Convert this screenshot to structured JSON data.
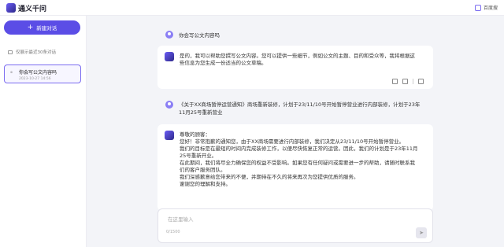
{
  "app": {
    "title": "通义千问"
  },
  "user": {
    "name": "百度搜"
  },
  "sidebar": {
    "new_chat_label": "新建对话",
    "history_note": "仅展示最近30条对话",
    "conversations": [
      {
        "title": "你会写公文内容吗",
        "time": "2023-10-27 14:56"
      }
    ]
  },
  "chat": {
    "q1": "你会写公文内容吗",
    "a1": "是的，我可以帮助您撰写公文内容。您可以提供一些细节，例如公文的主题、目的和受众等，我将根据这些信息为您生成一份适当的公文草稿。",
    "q2": "《关于XX商场暂停运营通知》商场重新装修，计划于23/11/10号开始暂停营业进行内部装修，计划于23年11月25号重新营业",
    "a2": [
      "尊敬的顾客：",
      "您好！非常抱歉的通知您，由于XX商场需要进行内部装修，我们决定从23/11/10号开始暂停营业。",
      "我们的目标是在最短的时间内完成装修工作，以便尽快恢复正常的运营。因此，我们的计划是于23年11月25号重新开业。",
      "在此期间，我们将尽全力确保您的权益不受影响。如果您有任何疑问或需要进一步的帮助，请随时联系我们的客户服务团队。",
      "我们深感歉意给您带来的不便，并期待在不久的将来再次为您提供优质的服务。",
      "谢谢您的理解和支持。"
    ]
  },
  "input": {
    "placeholder": "在这里输入",
    "counter": "0/1500"
  }
}
